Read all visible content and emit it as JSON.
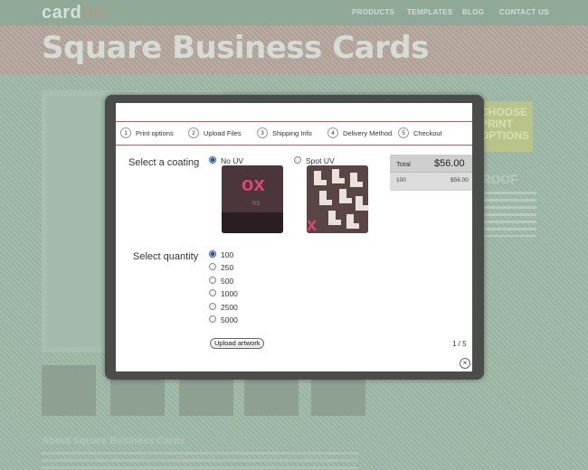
{
  "site": {
    "logo_main": "card",
    "logo_accent": "fox",
    "nav": [
      "PRODUCTS",
      "TEMPLATES",
      "BLOG",
      "CONTACT US"
    ],
    "hero_title": "Square Business Cards",
    "sidebar_choose": [
      "CHOOSE",
      "PRINT",
      "OPTIONS"
    ],
    "sidebar_proof": "PROOF",
    "about_title": "About Square Business Cards"
  },
  "modal": {
    "steps": [
      {
        "num": "1",
        "label": "Print options"
      },
      {
        "num": "2",
        "label": "Upload Files"
      },
      {
        "num": "3",
        "label": "Shipping Info"
      },
      {
        "num": "4",
        "label": "Delivery Method"
      },
      {
        "num": "5",
        "label": "Checkout"
      }
    ],
    "coating": {
      "label": "Select a coating",
      "options": [
        {
          "label": "No UV",
          "checked": true
        },
        {
          "label": "Spot UV",
          "checked": false
        }
      ]
    },
    "quantity": {
      "label": "Select quantity",
      "options": [
        "100",
        "250",
        "500",
        "1000",
        "2500",
        "5000"
      ],
      "selected": "100"
    },
    "summary": {
      "total_label": "Total",
      "total_value": "$56.00",
      "line_qty": "100",
      "line_price": "$56.00"
    },
    "upload_label": "Upload artwork",
    "pager": "1 / 5",
    "close_glyph": "×"
  },
  "colors": {
    "accent_line": "#c05a60",
    "radio_selected": "#2e4f9a",
    "modal_border": "#4a4d4a"
  }
}
